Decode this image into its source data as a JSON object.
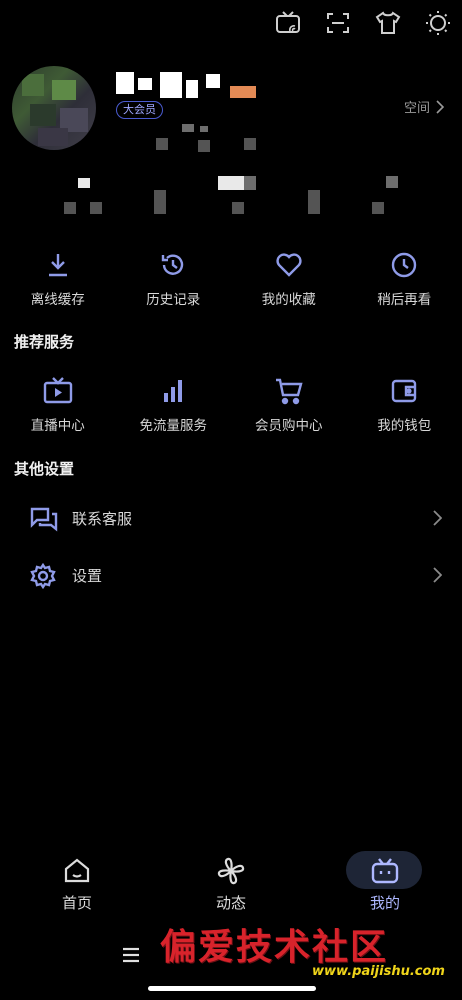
{
  "profile": {
    "vip_badge": "大会员",
    "space_label": "空间"
  },
  "top_icons": [
    "tv-cast-icon",
    "scan-icon",
    "tshirt-icon",
    "theme-sun-icon"
  ],
  "quick_actions": [
    {
      "label": "离线缓存",
      "icon": "download-icon"
    },
    {
      "label": "历史记录",
      "icon": "history-icon"
    },
    {
      "label": "我的收藏",
      "icon": "heart-icon"
    },
    {
      "label": "稍后再看",
      "icon": "clock-icon"
    }
  ],
  "recommended": {
    "title": "推荐服务",
    "items": [
      {
        "label": "直播中心",
        "icon": "live-tv-icon"
      },
      {
        "label": "免流量服务",
        "icon": "signal-bars-icon"
      },
      {
        "label": "会员购中心",
        "icon": "cart-icon"
      },
      {
        "label": "我的钱包",
        "icon": "wallet-icon"
      }
    ]
  },
  "other_settings": {
    "title": "其他设置",
    "rows": [
      {
        "label": "联系客服",
        "icon": "chat-icon"
      },
      {
        "label": "设置",
        "icon": "gear-icon"
      }
    ]
  },
  "bottom_nav": [
    {
      "label": "首页",
      "icon": "home-icon"
    },
    {
      "label": "动态",
      "icon": "pinwheel-icon"
    },
    {
      "label": "我的",
      "icon": "bilibili-tv-icon",
      "active": true
    }
  ],
  "watermark": {
    "text": "偏爱技术社区",
    "url": "www.paijishu.com"
  },
  "colors": {
    "accent": "#aeb8ff",
    "icon_blue": "#8f9be8",
    "background": "#000000"
  }
}
